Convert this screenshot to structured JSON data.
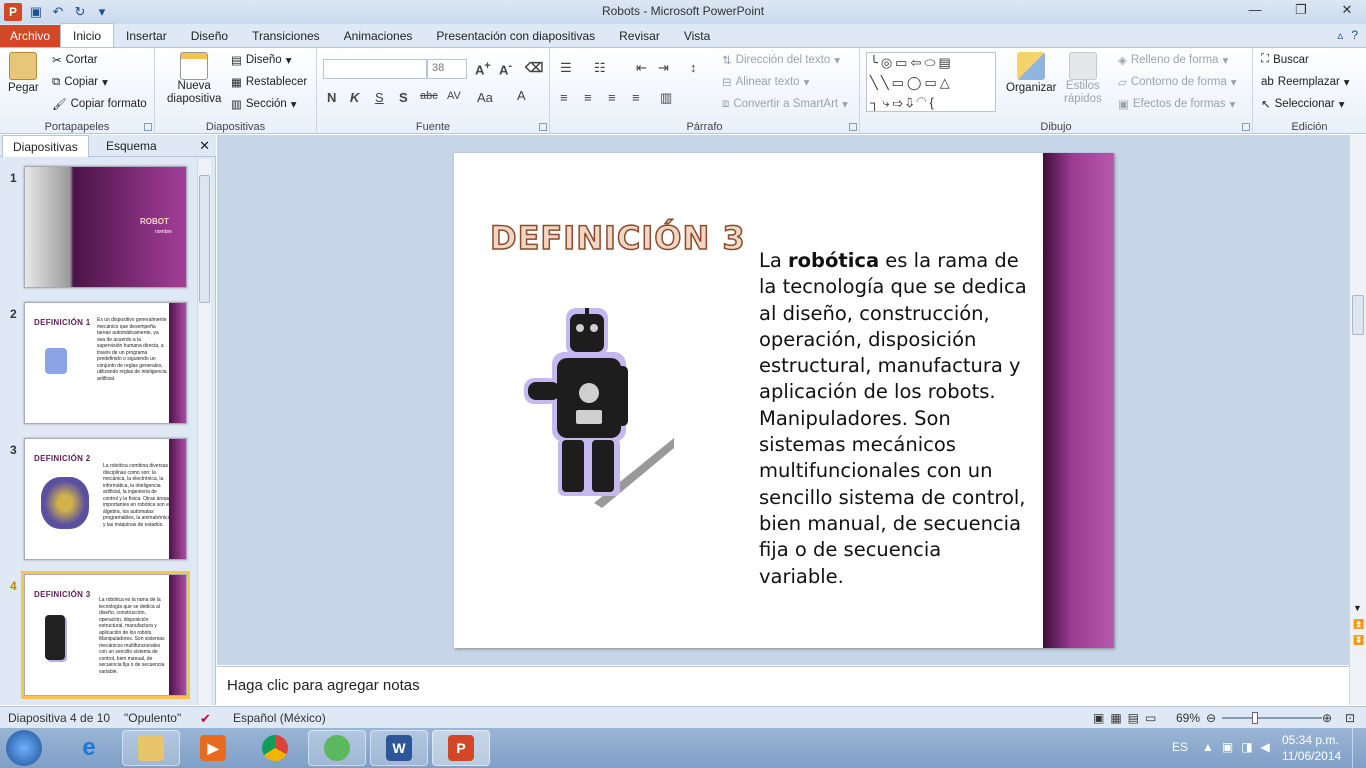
{
  "window": {
    "title": "Robots - Microsoft PowerPoint"
  },
  "tabs": [
    "Archivo",
    "Inicio",
    "Insertar",
    "Diseño",
    "Transiciones",
    "Animaciones",
    "Presentación con diapositivas",
    "Revisar",
    "Vista"
  ],
  "ribbon": {
    "portapapeles": {
      "label": "Portapapeles",
      "paste": "Pegar",
      "cut": "Cortar",
      "copy": "Copiar",
      "format_painter": "Copiar formato"
    },
    "diapositivas": {
      "label": "Diapositivas",
      "new_slide_1": "Nueva",
      "new_slide_2": "diapositiva",
      "layout": "Diseño",
      "reset": "Restablecer",
      "section": "Sección"
    },
    "fuente": {
      "label": "Fuente",
      "font_name": "",
      "font_size": "38"
    },
    "parrafo": {
      "label": "Párrafo",
      "text_direction": "Dirección del texto",
      "align_text": "Alinear texto",
      "smartart": "Convertir a SmartArt"
    },
    "dibujo": {
      "label": "Dibujo",
      "arrange": "Organizar",
      "quick_styles_1": "Estilos",
      "quick_styles_2": "rápidos",
      "fill": "Relleno de forma",
      "outline": "Contorno de forma",
      "effects": "Efectos de formas"
    },
    "edicion": {
      "label": "Edición",
      "find": "Buscar",
      "replace": "Reemplazar",
      "select": "Seleccionar"
    }
  },
  "left_pane": {
    "tabs": [
      "Diapositivas",
      "Esquema"
    ],
    "slides": [
      {
        "num": "1",
        "title": "ROBOT",
        "subtitle": "nombre"
      },
      {
        "num": "2",
        "title": "DEFINICIÓN 1",
        "body": "Es un dispositivo generalmente mecánico que desempeña tareas automáticamente, ya sea de acuerdo a la supervisión humana directa, a través de un programa predefinido o siguiendo un conjunto de reglas generales, utilizando reglas de inteligencia artificial."
      },
      {
        "num": "3",
        "title": "DEFINICIÓN 2",
        "body": "La robótica combina diversas disciplinas como son: la mecánica, la electrónica, la informática, la inteligencia artificial, la ingeniería de control y la física. Otras áreas importantes en robótica son el álgebra, los autómatas programables, la animatrónica y las máquinas de estados."
      },
      {
        "num": "4",
        "title": "DEFINICIÓN 3",
        "body": "La robótica es la rama de la tecnología que se dedica al diseño, construcción, operación, disposición estructural, manufactura y aplicación de los robots. Manipuladores. Son sistemas mecánicos multifuncionales con un sencillo sistema de control, bien manual, de secuencia fija o de secuencia variable."
      }
    ]
  },
  "slide": {
    "title": "DEFINICIÓN 3",
    "body_bold": "robótica",
    "body_pre": "La ",
    "body_post": " es la rama de la tecnología que se dedica al diseño, construcción, operación, disposición estructural, manufactura y aplicación de los robots. Manipuladores. Son sistemas mecánicos multifuncionales con un sencillo sistema de control, bien manual, de secuencia fija o de secuencia variable."
  },
  "notes": {
    "placeholder": "Haga clic para agregar notas"
  },
  "status": {
    "slide_info": "Diapositiva 4 de 10",
    "theme": "\"Opulento\"",
    "language": "Español (México)",
    "zoom": "69%"
  },
  "taskbar": {
    "lang": "ES",
    "time": "05:34 p.m.",
    "date": "11/06/2014"
  },
  "colors": {
    "accent": "#d24726",
    "slide_bar": "#8a3080"
  }
}
